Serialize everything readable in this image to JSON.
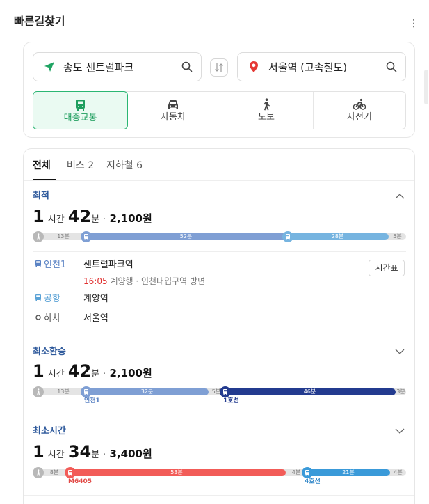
{
  "app": {
    "title": "빠른길찾기",
    "more_glyph": "⋮"
  },
  "search": {
    "origin": "송도 센트럴파크",
    "destination": "서울역 (고속철도)",
    "origin_icon": "navigation-arrow-icon",
    "destination_icon": "location-pin-icon",
    "colors": {
      "origin_icon": "#1fa463",
      "destination_icon": "#e53935"
    }
  },
  "modes": [
    {
      "label": "대중교통",
      "icon": "bus-icon",
      "active": true
    },
    {
      "label": "자동차",
      "icon": "car-icon",
      "active": false
    },
    {
      "label": "도보",
      "icon": "walk-icon",
      "active": false
    },
    {
      "label": "자전거",
      "icon": "bicycle-icon",
      "active": false
    }
  ],
  "tabs": [
    {
      "label": "전체",
      "active": true
    },
    {
      "label": "버스 2",
      "active": false
    },
    {
      "label": "지하철 6",
      "active": false
    }
  ],
  "routes": [
    {
      "label": "최적",
      "expanded": true,
      "hours": "1",
      "hours_unit": "시간",
      "minutes": "42",
      "minutes_unit": "분",
      "separator": "·",
      "price": "2,100원",
      "segments": [
        {
          "type": "walk",
          "label": "13분",
          "color": "#e4e4e4"
        },
        {
          "type": "bus",
          "label": "52분",
          "color": "#7f9fd4"
        },
        {
          "type": "bus",
          "label": "28분",
          "color": "#76b4e0"
        },
        {
          "type": "walk",
          "label": "5분",
          "color": "#e4e4e4"
        }
      ],
      "steps": [
        {
          "mode_label": "인천1",
          "mode_color": "#5b83c4",
          "station": "센트럴파크역",
          "info_time": "16:05",
          "info_rest": "계양행 · 인천대입구역 방면",
          "action": "시간표"
        },
        {
          "mode_label": "공항",
          "mode_color": "#5aa2d6",
          "station": "계양역"
        },
        {
          "mode_label": "하차",
          "mode_color": "#555555",
          "station": "서울역"
        }
      ]
    },
    {
      "label": "최소환승",
      "expanded": false,
      "hours": "1",
      "hours_unit": "시간",
      "minutes": "42",
      "minutes_unit": "분",
      "separator": "·",
      "price": "2,100원",
      "segments": [
        {
          "type": "walk",
          "label": "13분",
          "color": "#e4e4e4"
        },
        {
          "type": "bus",
          "label": "32분",
          "color": "#7f9fd4",
          "note": "인천1",
          "note_color": "#5b83c4"
        },
        {
          "type": "walk",
          "label": "5분",
          "color": "#e4e4e4"
        },
        {
          "type": "bus",
          "label": "46분",
          "color": "#233b8f",
          "note": "1호선",
          "note_color": "#233b8f"
        },
        {
          "type": "walk",
          "label": "3분",
          "color": "#e4e4e4"
        }
      ]
    },
    {
      "label": "최소시간",
      "expanded": false,
      "hours": "1",
      "hours_unit": "시간",
      "minutes": "34",
      "minutes_unit": "분",
      "separator": "·",
      "price": "3,400원",
      "segments": [
        {
          "type": "walk",
          "label": "8분",
          "color": "#e4e4e4"
        },
        {
          "type": "bus",
          "label": "53분",
          "color": "#f25c58",
          "note": "M6405",
          "note_color": "#e24a46"
        },
        {
          "type": "walk",
          "label": "4분",
          "color": "#e4e4e4"
        },
        {
          "type": "bus",
          "label": "21분",
          "color": "#3a9ad9",
          "note": "4호선",
          "note_color": "#2f86c8"
        },
        {
          "type": "walk",
          "label": "4분",
          "color": "#e4e4e4"
        }
      ]
    }
  ]
}
